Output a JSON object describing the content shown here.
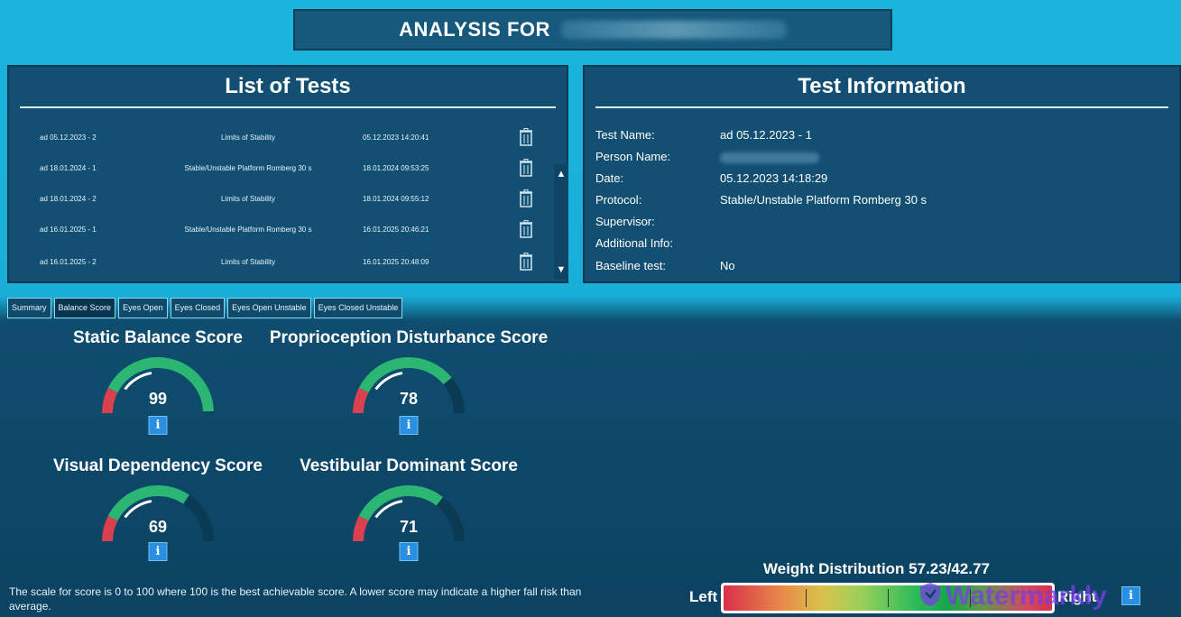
{
  "header": {
    "title": "ANALYSIS FOR"
  },
  "tests_panel": {
    "title": "List of Tests",
    "rows": [
      {
        "name": "ad 05.12.2023 - 2",
        "protocol": "Limits of Stability",
        "datetime": "05.12.2023 14:20:41"
      },
      {
        "name": "ad 18.01.2024 - 1",
        "protocol": "Stable/Unstable Platform Romberg 30 s",
        "datetime": "18.01.2024 09:53:25"
      },
      {
        "name": "ad 18.01.2024 - 2",
        "protocol": "Limits of Stability",
        "datetime": "18.01.2024 09:55:12"
      },
      {
        "name": "ad 16.01.2025 - 1",
        "protocol": "Stable/Unstable Platform Romberg 30 s",
        "datetime": "16.01.2025 20:46:21"
      },
      {
        "name": "ad 16.01.2025 - 2",
        "protocol": "Limits of Stability",
        "datetime": "16.01.2025 20:48:09"
      }
    ],
    "icons": {
      "delete": "trash-icon",
      "scroll_up": "arrow-up-icon",
      "scroll_down": "arrow-down-icon"
    }
  },
  "info_panel": {
    "title": "Test Information",
    "fields": {
      "test_name": {
        "label": "Test Name:",
        "value": "ad 05.12.2023 - 1"
      },
      "person_name": {
        "label": "Person Name:",
        "value": ""
      },
      "date": {
        "label": "Date:",
        "value": "05.12.2023 14:18:29"
      },
      "protocol": {
        "label": "Protocol:",
        "value": "Stable/Unstable Platform Romberg 30 s"
      },
      "supervisor": {
        "label": "Supervisor:",
        "value": ""
      },
      "additional_info": {
        "label": "Additional Info:",
        "value": ""
      },
      "baseline": {
        "label": "Baseline test:",
        "value": "No"
      }
    }
  },
  "tabs": [
    "Summary",
    "Balance Score",
    "Eyes Open",
    "Eyes Closed",
    "Eyes Open Unstable",
    "Eyes Closed Unstable"
  ],
  "active_tab": "Balance Score",
  "gauges": {
    "static": {
      "title": "Static Balance Score",
      "value": "99"
    },
    "proprio": {
      "title": "Proprioception Disturbance Score",
      "value": "78"
    },
    "visual": {
      "title": "Visual Dependency Score",
      "value": "69"
    },
    "vestibular": {
      "title": "Vestibular Dominant Score",
      "value": "71"
    },
    "info_button": "i"
  },
  "footnote": "The scale for score is 0 to 100 where 100 is the best achievable score. A lower score may indicate a higher fall risk than average.",
  "weight_distribution": {
    "title": "Weight Distribution 57.23/42.77",
    "left_label": "Left",
    "right_label": "Right",
    "left_percent": 57.23,
    "right_percent": 42.77
  },
  "watermark": "Watermarkly",
  "colors": {
    "accent_cyan": "#1ab4dc",
    "panel": "#124f72",
    "gauge_green": "#2bb673",
    "gauge_red": "#d94050",
    "info_blue": "#2a8fe0"
  }
}
